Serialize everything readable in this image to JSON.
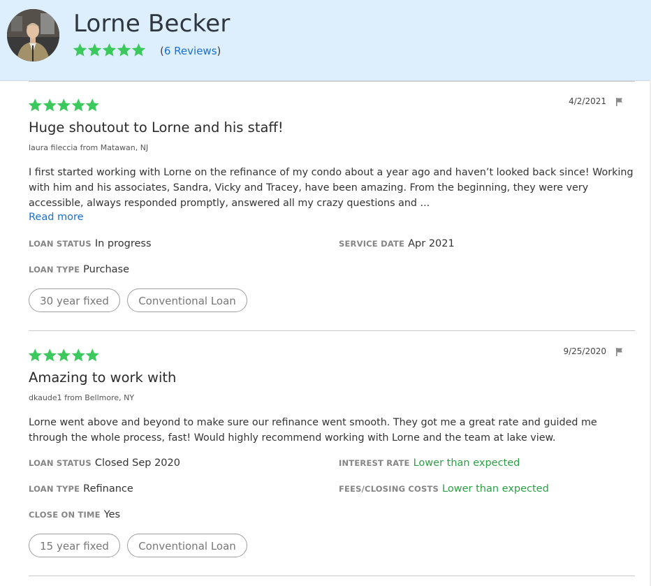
{
  "colors": {
    "header_bg": "#ddeefc",
    "star_green": "#3bc95e",
    "link_blue": "#1b6fd0",
    "value_green": "#2c9f45"
  },
  "profile": {
    "name": "Lorne Becker",
    "rating": 5,
    "reviews_open": "(",
    "reviews_link": "6 Reviews",
    "reviews_close": ")"
  },
  "reviews": [
    {
      "rating": 5,
      "date": "4/2/2021",
      "title": "Huge shoutout to Lorne and his staff!",
      "reviewer": "laura fileccia from Matawan, NJ",
      "body": "I first started working with Lorne on the refinance of my condo about a year ago and haven’t looked back since! Working with him and his associates, Sandra, Vicky and Tracey, have been amazing. From the beginning, they were very accessible, always responded promptly, answered all my crazy questions and ...",
      "read_more": "Read more",
      "loan_status_label": "LOAN STATUS",
      "loan_status": "In progress",
      "service_date_label": "SERVICE DATE",
      "service_date": "Apr 2021",
      "loan_type_label": "LOAN TYPE",
      "loan_type": "Purchase",
      "tags": [
        "30 year fixed",
        "Conventional Loan"
      ]
    },
    {
      "rating": 5,
      "date": "9/25/2020",
      "title": "Amazing to work with",
      "reviewer": "dkaude1 from Bellmore, NY",
      "body": "Lorne went above and beyond to make sure our refinance went smooth. They got me a great rate and guided me through the whole process, fast! Would highly recommend working with Lorne and the team at lake view.",
      "loan_status_label": "LOAN STATUS",
      "loan_status": "Closed Sep 2020",
      "interest_rate_label": "INTEREST RATE",
      "interest_rate": "Lower than expected",
      "loan_type_label": "LOAN TYPE",
      "loan_type": "Refinance",
      "fees_label": "FEES/CLOSING COSTS",
      "fees": "Lower than expected",
      "close_on_time_label": "CLOSE ON TIME",
      "close_on_time": "Yes",
      "tags": [
        "15 year fixed",
        "Conventional Loan"
      ]
    }
  ]
}
